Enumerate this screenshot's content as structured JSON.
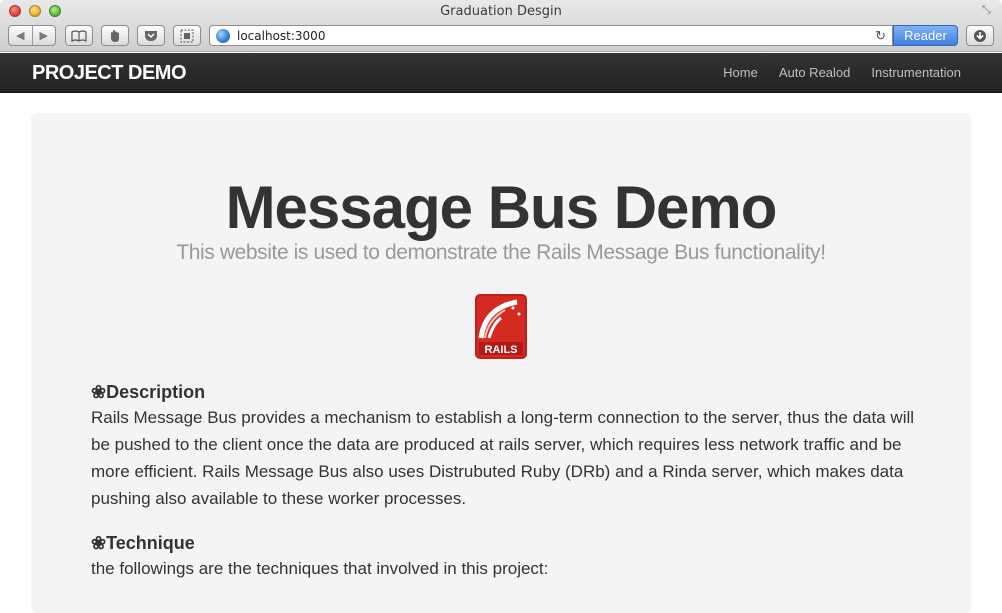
{
  "window": {
    "title": "Graduation Desgin",
    "url": "localhost:3000",
    "reader_label": "Reader"
  },
  "navbar": {
    "brand": "PROJECT DEMO",
    "links": [
      "Home",
      "Auto Realod",
      "Instrumentation"
    ]
  },
  "hero": {
    "title": "Message Bus Demo",
    "subtitle": "This website is used to demonstrate the Rails Message Bus functionality!",
    "logo_text": "RAILS"
  },
  "sections": [
    {
      "heading": "❀Description",
      "body": "Rails Message Bus provides a mechanism to establish a long-term connection to the server, thus the data will be pushed to the client once the data are produced at rails server, which requires less network traffic and be more efficient. Rails Message Bus also uses Distrubuted Ruby (DRb) and a Rinda server, which makes data pushing also available to these worker processes."
    },
    {
      "heading": "❀Technique",
      "body": "the followings are the techniques that involved in this project:"
    }
  ],
  "colors": {
    "navbar": "#222222",
    "hero_bg": "#f4f4f4",
    "reader_button": "#3e7fe0",
    "rails_red": "#c0201b"
  }
}
